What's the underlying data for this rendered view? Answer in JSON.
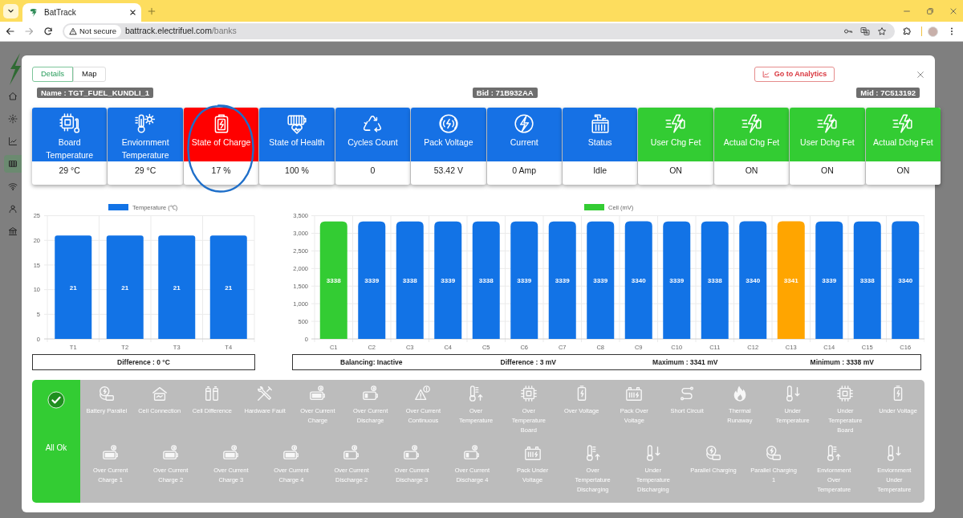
{
  "browser": {
    "tab_title": "BatTrack",
    "security_label": "Not secure",
    "url_host": "battrack.electrifuel.com",
    "url_path": "/banks"
  },
  "sidebar": {
    "items": [
      {
        "kind": "home",
        "selected": false
      },
      {
        "kind": "settings",
        "selected": false
      },
      {
        "kind": "chart",
        "selected": false
      },
      {
        "kind": "grid",
        "selected": true
      },
      {
        "kind": "wifi",
        "selected": false
      },
      {
        "kind": "user",
        "selected": false
      },
      {
        "kind": "bank",
        "selected": false
      }
    ]
  },
  "modal": {
    "tabs": [
      {
        "label": "Details",
        "selected": true
      },
      {
        "label": "Map",
        "selected": false
      }
    ],
    "analytics_button": "Go to Analytics",
    "badges": [
      "Name : TGT_FUEL_KUNDLI_1",
      "Bid : 71B932AA",
      "Mid : 7C513192"
    ],
    "cards": [
      {
        "label": "Board Temperature",
        "value": "29 °C",
        "color": "#1671e5",
        "kind": "chip",
        "circled": false
      },
      {
        "label": "Enviornment Temperature",
        "value": "29 °C",
        "color": "#1671e5",
        "kind": "thermometer",
        "circled": false
      },
      {
        "label": "State of Charge",
        "value": "17 %",
        "color": "#ff0000",
        "kind": "battery",
        "circled": true
      },
      {
        "label": "State of Health",
        "value": "100 %",
        "color": "#1671e5",
        "kind": "health",
        "circled": false
      },
      {
        "label": "Cycles Count",
        "value": "0",
        "color": "#1671e5",
        "kind": "cycles",
        "circled": false
      },
      {
        "label": "Pack Voltage",
        "value": "53.42 V",
        "color": "#1671e5",
        "kind": "voltage",
        "circled": false
      },
      {
        "label": "Current",
        "value": "0 Amp",
        "color": "#1671e5",
        "kind": "current",
        "circled": false
      },
      {
        "label": "Status",
        "value": "Idle",
        "color": "#1671e5",
        "kind": "status",
        "circled": false
      },
      {
        "label": "User Chg Fet",
        "value": "ON",
        "color": "#33cc33",
        "kind": "fet",
        "circled": false
      },
      {
        "label": "Actual Chg Fet",
        "value": "ON",
        "color": "#33cc33",
        "kind": "fet",
        "circled": false
      },
      {
        "label": "User Dchg Fet",
        "value": "ON",
        "color": "#33cc33",
        "kind": "fet",
        "circled": false
      },
      {
        "label": "Actual Dchg Fet",
        "value": "ON",
        "color": "#33cc33",
        "kind": "fet",
        "circled": false
      }
    ],
    "temperature_chart": {
      "chart_data": {
        "type": "bar",
        "categories": [
          "T1",
          "T2",
          "T3",
          "T4"
        ],
        "series": [
          {
            "name": "Temperature (℃)",
            "color": "#1273e6",
            "values": [
              21,
              21,
              21,
              21
            ]
          }
        ],
        "ylim": [
          0,
          25
        ],
        "yticks": [
          0,
          5,
          10,
          15,
          20,
          25
        ],
        "grid": true,
        "data_labels": true
      },
      "summary": [
        "Difference : 0 °C"
      ]
    },
    "cell_chart": {
      "chart_data": {
        "type": "bar",
        "categories": [
          "C1",
          "C2",
          "C3",
          "C4",
          "C5",
          "C6",
          "C7",
          "C8",
          "C9",
          "C10",
          "C11",
          "C12",
          "C13",
          "C14",
          "C15",
          "C16"
        ],
        "series": [
          {
            "name": "Cell (mV)",
            "color": "#33cc33",
            "values": [
              3338,
              3339,
              3338,
              3339,
              3338,
              3339,
              3339,
              3339,
              3340,
              3339,
              3338,
              3340,
              3341,
              3339,
              3338,
              3340
            ],
            "colors": [
              "#33cc33",
              "#1273e6",
              "#1273e6",
              "#1273e6",
              "#1273e6",
              "#1273e6",
              "#1273e6",
              "#1273e6",
              "#1273e6",
              "#1273e6",
              "#1273e6",
              "#1273e6",
              "#ffa500",
              "#1273e6",
              "#1273e6",
              "#1273e6"
            ]
          }
        ],
        "ylim": [
          0,
          3500
        ],
        "yticks": [
          0,
          500,
          {
            "value": 1000,
            "label": "1,000"
          },
          {
            "value": 1500,
            "label": "1,500"
          },
          {
            "value": 2000,
            "label": "2,000"
          },
          {
            "value": 2500,
            "label": "2,500"
          },
          {
            "value": 3000,
            "label": "3,000"
          },
          {
            "value": 3500,
            "label": "3,500"
          }
        ],
        "grid": true,
        "data_labels": true
      },
      "summary": [
        "Balancing: Inactive",
        "Difference : 3 mV",
        "Maximum : 3341 mV",
        "Minimum : 3338 mV"
      ]
    },
    "alarms": {
      "status": "All Ok",
      "all_ok": true,
      "rows": [
        {
          "items": [
            {
              "label": "Battery Parallel",
              "kind": "parallel"
            },
            {
              "label": "Cell Connection",
              "kind": "connection"
            },
            {
              "label": "Cell Difference",
              "kind": "cells"
            },
            {
              "label": "Hardware Fault",
              "kind": "tools"
            },
            {
              "label": "Over Current Charge",
              "kind": "battery"
            },
            {
              "label": "Over Current Discharge",
              "kind": "drain"
            },
            {
              "label": "Over Current Continuous",
              "kind": "warning"
            },
            {
              "label": "Over Temperature",
              "kind": "hot"
            },
            {
              "label": "Over Temperature Board",
              "kind": "chip"
            },
            {
              "label": "Over Voltage",
              "kind": "cell"
            },
            {
              "label": "Pack Over Voltage",
              "kind": "pack"
            },
            {
              "label": "Short Circuit",
              "kind": "short"
            },
            {
              "label": "Thermal Runaway",
              "kind": "flame"
            },
            {
              "label": "Under Temperature",
              "kind": "cold"
            },
            {
              "label": "Under Temperature Board",
              "kind": "chip"
            },
            {
              "label": "Under Voltage",
              "kind": "cell"
            }
          ]
        },
        {
          "items": [
            {
              "label": "Over Current Charge 1",
              "kind": "battery"
            },
            {
              "label": "Over Current Charge 2",
              "kind": "battery"
            },
            {
              "label": "Over Current Charge 3",
              "kind": "battery"
            },
            {
              "label": "Over Current Charge 4",
              "kind": "battery"
            },
            {
              "label": "Over Current Discharge 2",
              "kind": "drain"
            },
            {
              "label": "Over Current Discharge 3",
              "kind": "drain"
            },
            {
              "label": "Over Current Discharge 4",
              "kind": "drain"
            },
            {
              "label": "Pack Under Voltage",
              "kind": "pack"
            },
            {
              "label": "Over Tempertature Discharging",
              "kind": "hot"
            },
            {
              "label": "Under Temperature Discharging",
              "kind": "cold"
            },
            {
              "label": "Parallel Charging",
              "kind": "parallel"
            },
            {
              "label": "Parallel Charging 1",
              "kind": "parallel"
            },
            {
              "label": "Enviornment Over Temperature",
              "kind": "hot"
            },
            {
              "label": "Enviornment Under Temperature",
              "kind": "cold"
            }
          ]
        }
      ]
    }
  }
}
